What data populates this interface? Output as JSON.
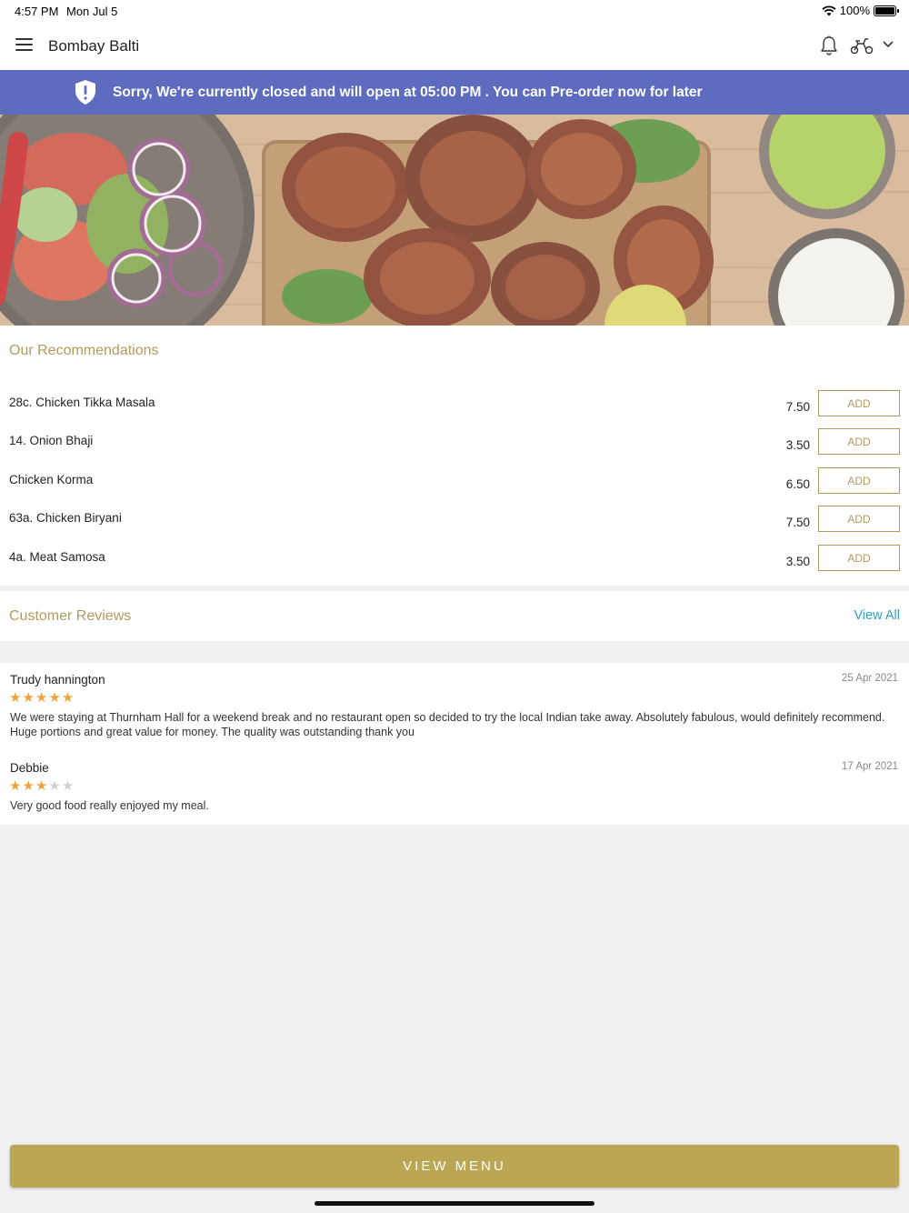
{
  "status_bar": {
    "time": "4:57 PM",
    "date": "Mon Jul 5",
    "battery": "100%",
    "icons": [
      "wifi-icon",
      "battery-icon"
    ]
  },
  "header": {
    "title": "Bombay Balti",
    "icons": [
      "hamburger-menu-icon",
      "bell-icon",
      "scooter-icon",
      "chevron-down-icon"
    ]
  },
  "banner": {
    "text": "Sorry, We're currently closed and will open at 05:00 PM . You can Pre-order now for later",
    "icon": "shield-exclamation-icon",
    "color": "#5d6cbf"
  },
  "recommendations": {
    "title": "Our Recommendations",
    "add_label": "ADD",
    "items": [
      {
        "name": "28c. Chicken Tikka Masala",
        "price": "7.50"
      },
      {
        "name": "14. Onion Bhaji",
        "price": "3.50"
      },
      {
        "name": "Chicken Korma",
        "price": "6.50"
      },
      {
        "name": "63a. Chicken Biryani",
        "price": "7.50"
      },
      {
        "name": "4a. Meat Samosa",
        "price": "3.50"
      }
    ]
  },
  "reviews": {
    "title": "Customer Reviews",
    "view_all": "View All",
    "items": [
      {
        "name": "Trudy hannington",
        "date": "25 Apr 2021",
        "rating": 5,
        "text": "We were staying at Thurnham Hall for a weekend break and no restaurant open so decided to try the local Indian take away. Absolutely fabulous, would definitely recommend. Huge portions and great value for money. The quality was outstanding thank you"
      },
      {
        "name": "Debbie",
        "date": "17 Apr 2021",
        "rating": 3,
        "text": "Very good food really enjoyed my meal."
      }
    ]
  },
  "footer": {
    "view_menu": "VIEW MENU"
  },
  "colors": {
    "accent": "#b09b5c",
    "button": "#bba654",
    "link": "#2f9ec0",
    "star": "#f0a23b"
  }
}
